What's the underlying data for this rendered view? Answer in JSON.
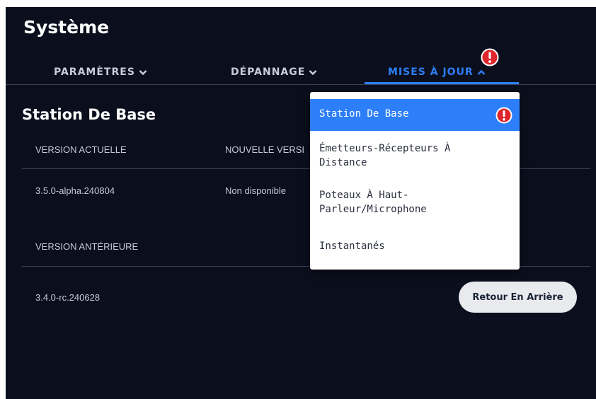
{
  "page": {
    "title": "Système"
  },
  "tabs": [
    {
      "label": "PARAMÈTRES",
      "icon": "chevron-down-icon",
      "active": false
    },
    {
      "label": "DÉPANNAGE",
      "icon": "chevron-down-icon",
      "active": false
    },
    {
      "label": "MISES À JOUR",
      "icon": "chevron-up-icon",
      "active": true,
      "badge": "alert-icon"
    }
  ],
  "section": {
    "title": "Station De Base",
    "current_version_label": "VERSION ACTUELLE",
    "new_version_label": "NOUVELLE VERSION",
    "current_version": "3.5.0-alpha.240804",
    "new_version": "Non disponible",
    "previous_version_label": "VERSION ANTÉRIEURE",
    "previous_version": "3.4.0-rc.240628",
    "rollback_button": "Retour En Arrière"
  },
  "dropdown": {
    "items": [
      {
        "label": "Station De Base",
        "selected": true,
        "badge": "alert-icon"
      },
      {
        "label": "Émetteurs-Récepteurs À Distance",
        "selected": false
      },
      {
        "label": "Poteaux À Haut-Parleur/Microphone",
        "selected": false
      },
      {
        "label": "Instantanés",
        "selected": false
      }
    ]
  },
  "colors": {
    "background": "#0b0f1d",
    "accent": "#2d7ff9",
    "alert": "#e0242b",
    "text": "#c4cad8",
    "divider": "#3a4258"
  }
}
